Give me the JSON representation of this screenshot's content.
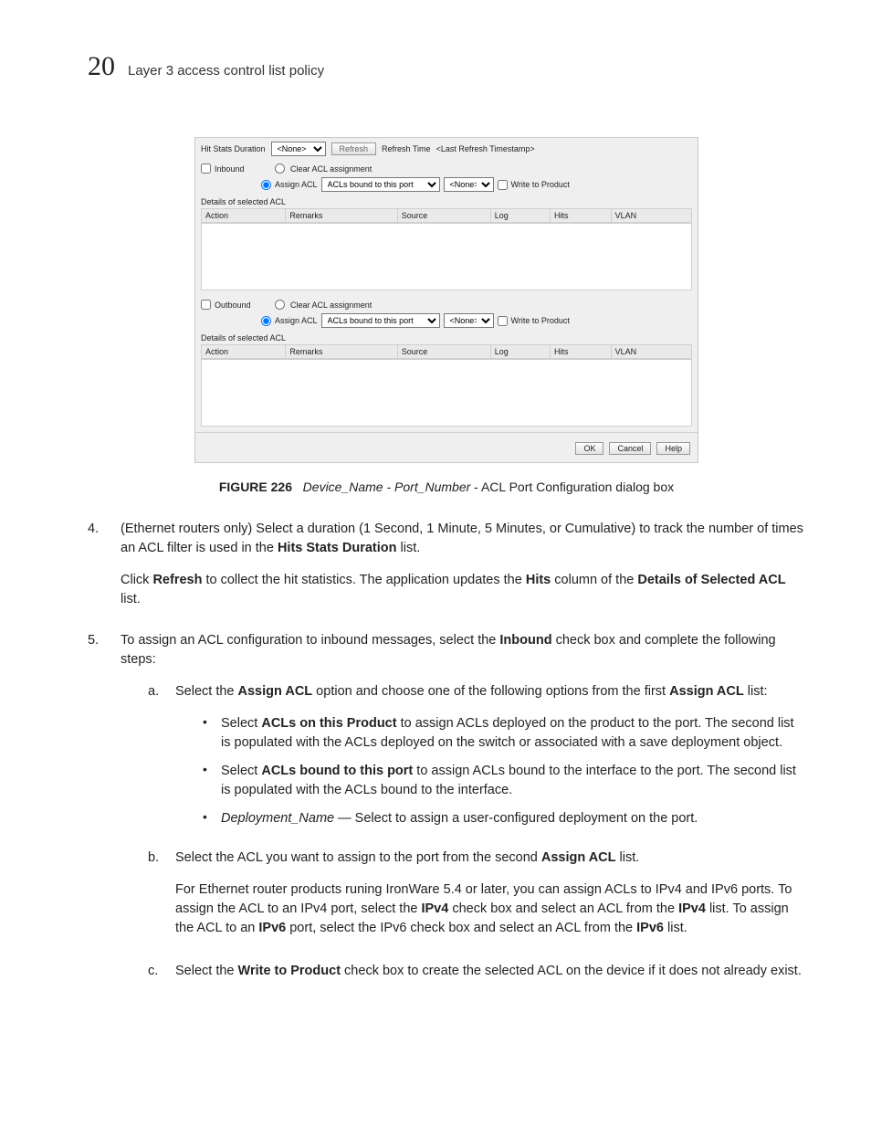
{
  "header": {
    "chapter_number": "20",
    "title": "Layer 3 access control list policy"
  },
  "figure": {
    "hit_stats_label": "Hit Stats Duration",
    "hit_stats_value": "<None>",
    "refresh_btn": "Refresh",
    "refresh_time_label": "Refresh Time",
    "refresh_time_value": "<Last Refresh Timestamp>",
    "inbound_label": "Inbound",
    "outbound_label": "Outbound",
    "clear_acl_label": "Clear ACL assignment",
    "assign_acl_label": "Assign ACL",
    "acl_list_value": "ACLs bound to this port",
    "none_value": "<None>",
    "write_product_label": "Write to Product",
    "details_label": "Details of selected ACL",
    "columns": {
      "action": "Action",
      "remarks": "Remarks",
      "source": "Source",
      "log": "Log",
      "hits": "Hits",
      "vlan": "VLAN"
    },
    "buttons": {
      "ok": "OK",
      "cancel": "Cancel",
      "help": "Help"
    }
  },
  "caption": {
    "figlabel": "FIGURE 226",
    "italic_part": "Device_Name - Port_Number",
    "tail": " - ACL Port Configuration dialog box"
  },
  "content": {
    "n4_marker": "4.",
    "n4_p1_a": "(Ethernet routers only) Select a duration (1 Second, 1 Minute, 5 Minutes, or Cumulative) to track the number of times an ACL filter is used in the ",
    "n4_p1_b": "Hits Stats Duration",
    "n4_p1_c": " list.",
    "n4_p2_a": "Click ",
    "n4_p2_b": "Refresh",
    "n4_p2_c": " to collect the hit statistics. The application updates the ",
    "n4_p2_d": "Hits",
    "n4_p2_e": " column of the ",
    "n4_p2_f": "Details of Selected ACL",
    "n4_p2_g": " list.",
    "n5_marker": "5.",
    "n5_intro_a": "To assign an ACL configuration to inbound messages, select the ",
    "n5_intro_b": "Inbound",
    "n5_intro_c": " check box and complete the following steps:",
    "a_marker": "a.",
    "a_p_a": "Select the ",
    "a_p_b": "Assign ACL",
    "a_p_c": " option and choose one of the following options from the first ",
    "a_p_d": "Assign ACL",
    "a_p_e": " list:",
    "bul1_a": "Select ",
    "bul1_b": "ACLs on this Product",
    "bul1_c": " to assign ACLs deployed on the product to the port. The second list is populated with the ACLs deployed on the switch or associated with a save deployment object.",
    "bul2_a": "Select ",
    "bul2_b": "ACLs bound to this port",
    "bul2_c": " to assign ACLs bound to the interface to the port. The second list is populated with the ACLs bound to the interface.",
    "bul3_a": "Deployment_Name",
    "bul3_b": " — Select to assign a user-configured deployment on the port.",
    "b_marker": "b.",
    "b_p1_a": "Select the ACL you want to assign to the port from the second ",
    "b_p1_b": "Assign ACL",
    "b_p1_c": " list.",
    "b_p2_a": "For Ethernet router products runing IronWare 5.4 or later, you can assign ACLs to IPv4 and IPv6 ports. To assign the ACL to an IPv4 port, select the ",
    "b_p2_b": "IPv4",
    "b_p2_c": " check box and select an ACL from the ",
    "b_p2_d": "IPv4",
    "b_p2_e": " list. To assign the ACL to an ",
    "b_p2_f": "IPv6",
    "b_p2_g": " port, select the IPv6 check box and select an ACL from the ",
    "b_p2_h": "IPv6",
    "b_p2_i": " list.",
    "c_marker": "c.",
    "c_p_a": "Select the ",
    "c_p_b": "Write to Product",
    "c_p_c": " check box to create the selected ACL on the device if it does not already exist."
  }
}
